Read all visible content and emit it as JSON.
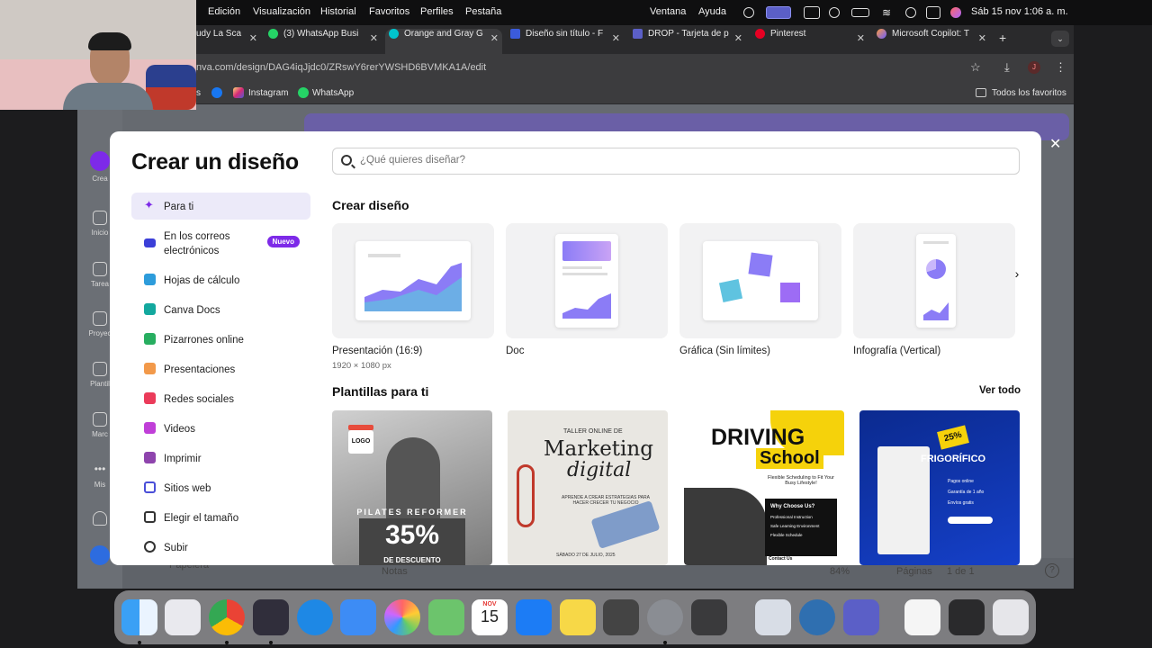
{
  "menubar": {
    "items": [
      "Edición",
      "Visualización",
      "Historial",
      "Favoritos",
      "Perfiles",
      "Pestaña"
    ],
    "right": [
      "Ventana",
      "Ayuda"
    ],
    "clock": "Sáb 15 nov  1:06 a. m."
  },
  "tabs": [
    {
      "title": "udy La Sca",
      "color": "#e0e0e0"
    },
    {
      "title": "(3) WhatsApp Busi",
      "color": "#25d366"
    },
    {
      "title": "Orange and Gray G",
      "color": "#00c4cc"
    },
    {
      "title": "Diseño sin título - F",
      "color": "#3b5bdb"
    },
    {
      "title": "DROP - Tarjeta de p",
      "color": "#5b5fc7"
    },
    {
      "title": "Pinterest",
      "color": "#e60023"
    },
    {
      "title": "Microsoft Copilot: T",
      "color": "#ff9a3d"
    }
  ],
  "address": {
    "url": "nva.com/design/DAG4iqJjdc0/ZRswY6rerYWSHD6BVMKA1A/edit"
  },
  "bookmarks": {
    "items": [
      "s",
      "Instagram",
      "WhatsApp"
    ],
    "all_label": "Todos los favoritos"
  },
  "canva_sidebar": [
    "Crea",
    "Inicio",
    "Tarea",
    "Proyec",
    "Plantil",
    "Marc",
    "Mis"
  ],
  "bottombar": {
    "trash": "Papelera",
    "notes": "Notas",
    "zoom": "84%",
    "pages": "Páginas",
    "page_count": "1 de 1"
  },
  "modal": {
    "title": "Crear un diseño",
    "search_placeholder": "¿Qué quieres diseñar?",
    "categories": [
      {
        "label": "Para ti",
        "icon": "sparkle-icon",
        "color": "#7d2ae8"
      },
      {
        "label": "En los correos\nelectrónicos",
        "icon": "mail-icon",
        "color": "#3b3fd8",
        "badge": "Nuevo"
      },
      {
        "label": "Hojas de cálculo",
        "icon": "spreadsheet-icon",
        "color": "#2d9cdb"
      },
      {
        "label": "Canva Docs",
        "icon": "doc-icon",
        "color": "#13a89e"
      },
      {
        "label": "Pizarrones online",
        "icon": "whiteboard-icon",
        "color": "#27ae60"
      },
      {
        "label": "Presentaciones",
        "icon": "presentation-icon",
        "color": "#f2994a"
      },
      {
        "label": "Redes sociales",
        "icon": "heart-icon",
        "color": "#eb3b5a"
      },
      {
        "label": "Videos",
        "icon": "video-icon",
        "color": "#c03fd8"
      },
      {
        "label": "Imprimir",
        "icon": "printer-icon",
        "color": "#8e44ad"
      },
      {
        "label": "Sitios web",
        "icon": "website-icon",
        "color": "#4a4fd8"
      },
      {
        "label": "Elegir el tamaño",
        "icon": "resize-icon",
        "color": "#333333"
      },
      {
        "label": "Subir",
        "icon": "upload-icon",
        "color": "#333333"
      }
    ],
    "create_heading": "Crear diseño",
    "designs": [
      {
        "label": "Presentación (16:9)",
        "sub": "1920 × 1080 px"
      },
      {
        "label": "Doc",
        "sub": ""
      },
      {
        "label": "Gráfica (Sin límites)",
        "sub": ""
      },
      {
        "label": "Infografía (Vertical)",
        "sub": ""
      }
    ],
    "templates_heading": "Plantillas para ti",
    "see_all": "Ver todo",
    "templates": [
      {
        "logo": "LOGO",
        "line1": "PILATES REFORMER",
        "big": "35%",
        "line2": "DE DESCUENTO"
      },
      {
        "small": "TALLER ONLINE DE",
        "title1": "Marketing",
        "title2": "digital",
        "note": "APRENDE A CREAR ESTRATEGIAS PARA HACER CRECER TU NEGOCIO",
        "date": "SÁBADO 27 DE JULIO, 2025"
      },
      {
        "title1": "DRIVING",
        "title2": "School",
        "sub": "Flexible Scheduling to Fit Your Busy Lifestyle!",
        "why": "Why Choose Us?",
        "items": [
          "Professional Instruction",
          "Safe Learning Environment",
          "Flexible Schedule"
        ],
        "contact": "Contact Us"
      },
      {
        "badge": "25%",
        "title": "FRIGORÍFICO",
        "items": [
          "Pagos online",
          "Garantía de 1 año",
          "Envíos gratis"
        ]
      }
    ]
  },
  "dock": {
    "calendar_month": "NOV",
    "calendar_day": "15"
  }
}
